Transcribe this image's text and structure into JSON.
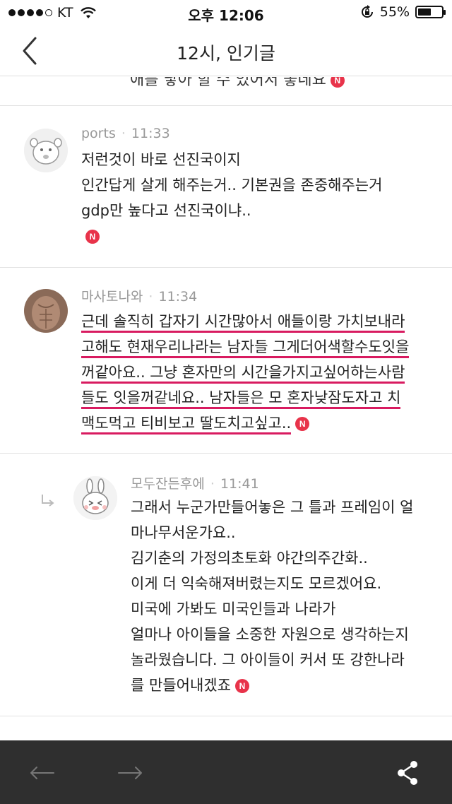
{
  "status_bar": {
    "carrier": "KT",
    "time": "오후 12:06",
    "battery_percent": "55%",
    "battery_level": 0.55,
    "signal_dots_filled": 4
  },
  "nav": {
    "title": "12시, 인기글",
    "back_icon": "chevron-left-icon"
  },
  "prev_comment_tail": "애를 낳아 할 수 있어서 좋네요",
  "comments": [
    {
      "author": "ports",
      "time": "11:33",
      "lines": [
        "저런것이 바로 선진국이지",
        "인간답게 살게 해주는거.. 기본권을 존중해주는거",
        "gdp만 높다고 선진국이냐.."
      ],
      "badge": "N"
    },
    {
      "author": "마사토나와",
      "time": "11:34",
      "lines": [
        "근데 솔직히 갑자기 시간많아서 애들이랑 가치보내라",
        "고해도 현재우리나라는 남자들 그게더어색할수도잇을",
        "꺼같아요.. 그냥 혼자만의 시간을가지고싶어하는사람",
        "들도 잇을꺼같네요.. 남자들은 모 혼자낮잠도자고 치",
        "맥도먹고 티비보고 딸도치고싶고.."
      ],
      "badge": "N"
    },
    {
      "author": "모두잔든후에",
      "time": "11:41",
      "is_reply": true,
      "lines": [
        "그래서 누군가만들어놓은 그 틀과 프레임이 얼",
        "마나무서운가요..",
        "김기춘의 가정의초토화 야간의주간화..",
        "이게 더 익숙해져버렸는지도 모르겠어요.",
        "미국에 가봐도 미국인들과 나라가",
        "얼마나 아이들을 소중한 자원으로 생각하는지",
        "놀라웠습니다. 그 아이들이 커서 또 강한나라",
        "를 만들어내겠죠"
      ],
      "badge": "N"
    }
  ],
  "toolbar": {
    "back_icon": "arrow-left-icon",
    "forward_icon": "arrow-right-icon",
    "share_icon": "share-icon"
  },
  "colors": {
    "highlight": "#d81b60",
    "badge": "#e8334a",
    "toolbar_bg": "#2f2f2f"
  }
}
